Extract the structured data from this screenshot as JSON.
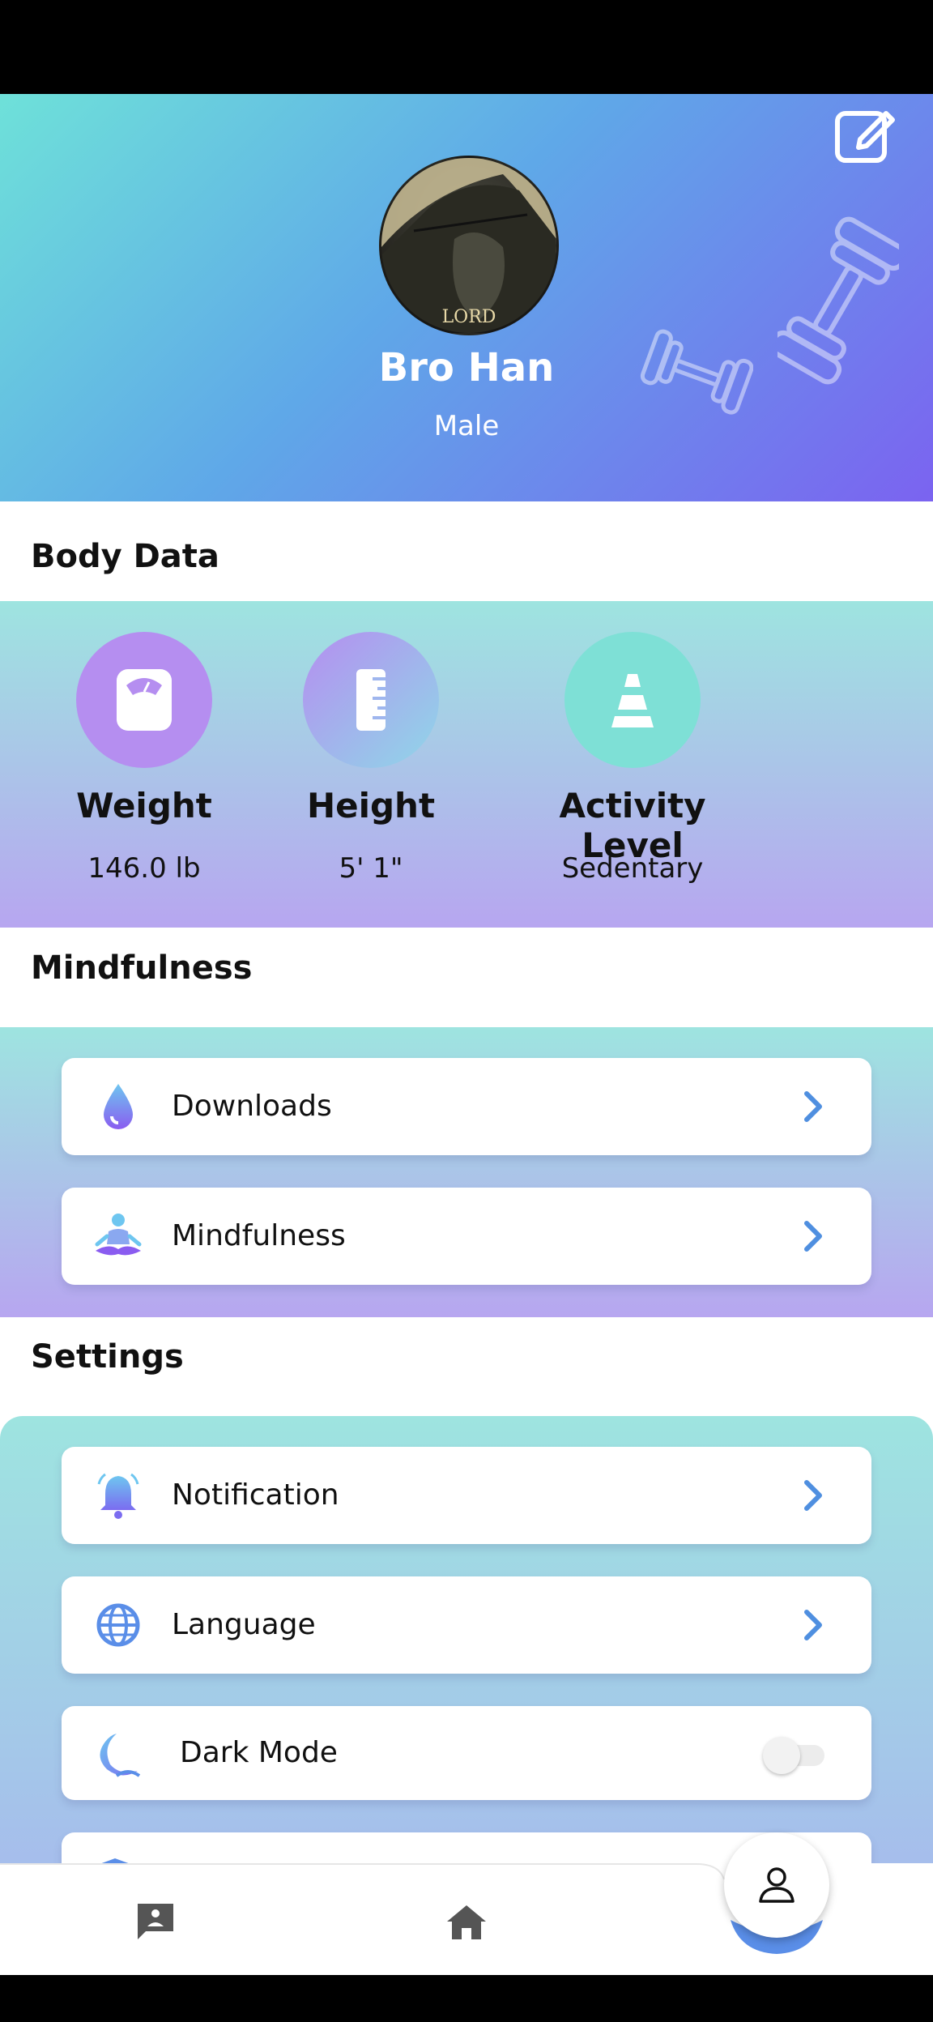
{
  "profile": {
    "name": "Bro Han",
    "gender": "Male",
    "avatar_caption": "LORD"
  },
  "body_data": {
    "title": "Body Data",
    "stats": [
      {
        "label": "Weight",
        "value": "146.0 lb",
        "icon": "scale-icon"
      },
      {
        "label": "Height",
        "value": "5' 1\"",
        "icon": "ruler-icon"
      },
      {
        "label": "Activity Level",
        "value": "Sedentary",
        "icon": "cone-icon"
      }
    ]
  },
  "mindfulness": {
    "title": "Mindfulness",
    "items": [
      {
        "label": "Downloads",
        "icon": "drop-icon"
      },
      {
        "label": "Mindfulness",
        "icon": "meditation-icon"
      }
    ]
  },
  "settings": {
    "title": "Settings",
    "items": [
      {
        "label": "Notification",
        "icon": "bell-icon"
      },
      {
        "label": "Language",
        "icon": "globe-icon"
      },
      {
        "label": "Dark Mode",
        "icon": "moon-icon",
        "toggle": false
      }
    ]
  },
  "nav": {
    "items": [
      "chat-icon",
      "home-icon",
      "profile-icon"
    ],
    "active": "profile-icon"
  },
  "colors": {
    "accent_blue": "#4f8fe0",
    "header_start": "#6ee1d9",
    "header_end": "#7b63f0",
    "panel_top": "#9ee4e0",
    "panel_bottom": "#b7a6f0"
  }
}
